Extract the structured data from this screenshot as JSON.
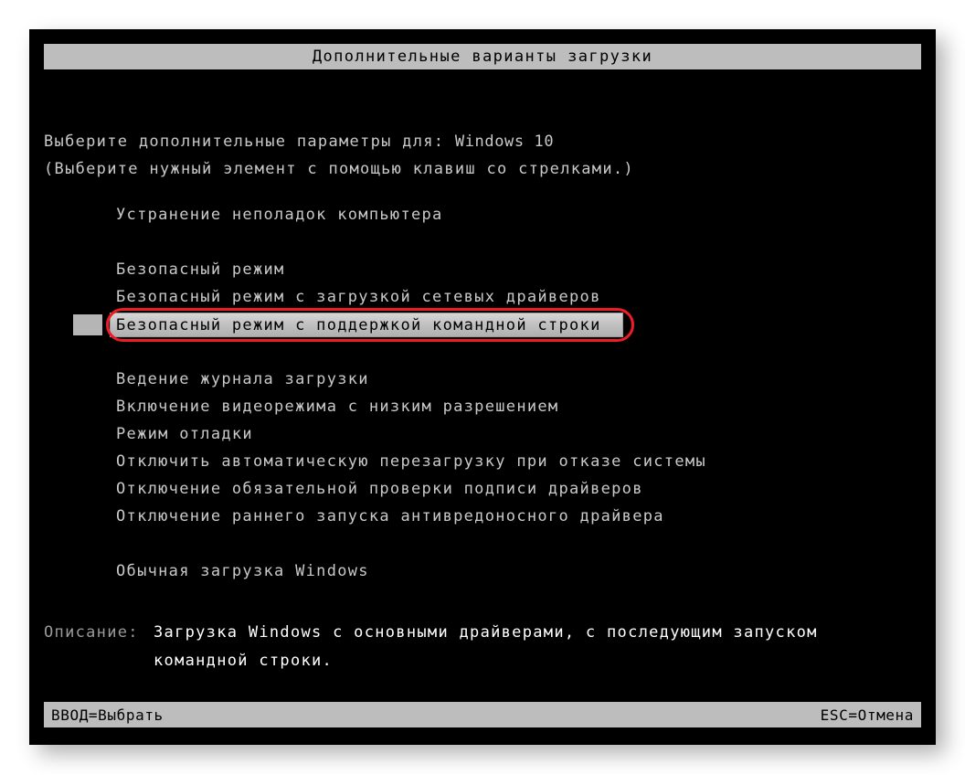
{
  "screen": {
    "title": "Дополнительные варианты загрузки",
    "background_color": "#000000",
    "bar_color": "#bdbdbd",
    "text_color": "#c9c9c9",
    "highlight_color": "#ee1c25"
  },
  "intro": {
    "line1_prefix": "Выберите дополнительные параметры для: ",
    "line1_os": "Windows 10",
    "line2": "(Выберите нужный элемент с помощью клавиш со стрелками.)"
  },
  "options": [
    {
      "label": "Устранение неполадок компьютера",
      "selected": false
    },
    {
      "label": "Безопасный режим",
      "selected": false
    },
    {
      "label": "Безопасный режим с загрузкой сетевых драйверов",
      "selected": false
    },
    {
      "label": "Безопасный режим с поддержкой командной строки",
      "selected": true
    },
    {
      "label": "Ведение журнала загрузки",
      "selected": false
    },
    {
      "label": "Включение видеорежима с низким разрешением",
      "selected": false
    },
    {
      "label": "Режим отладки",
      "selected": false
    },
    {
      "label": "Отключить автоматическую перезагрузку при отказе системы",
      "selected": false
    },
    {
      "label": "Отключение обязательной проверки подписи драйверов",
      "selected": false
    },
    {
      "label": "Отключение раннего запуска антивредоносного драйвера",
      "selected": false
    },
    {
      "label": "Обычная загрузка Windows",
      "selected": false
    }
  ],
  "description": {
    "label": "Описание:",
    "line1": "Загрузка Windows с основными драйверами, с последующим запуском",
    "line2": "командной строки."
  },
  "footer": {
    "left": "ВВОД=Выбрать",
    "right": "ESC=Отмена"
  }
}
